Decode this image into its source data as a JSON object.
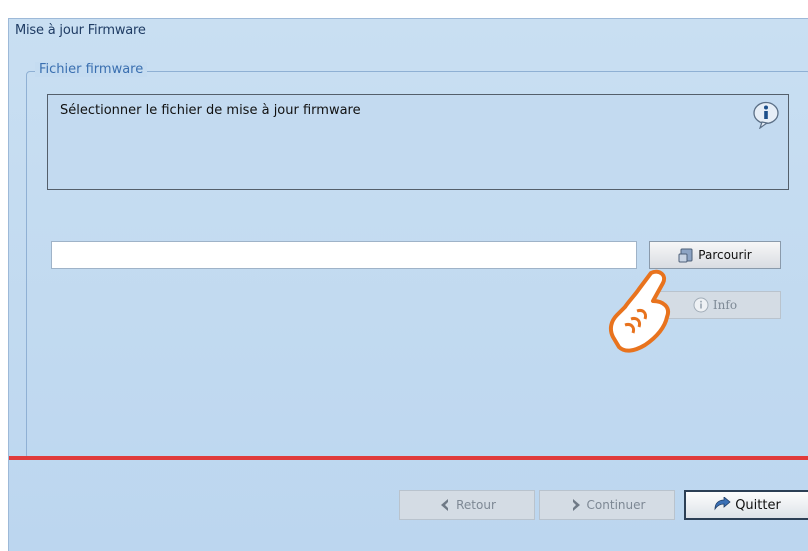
{
  "window": {
    "title": "Mise à jour Firmware"
  },
  "group": {
    "legend": "Fichier firmware",
    "info_text": "Sélectionner le fichier de mise à jour firmware"
  },
  "file_input": {
    "value": "",
    "placeholder": ""
  },
  "buttons": {
    "browse_label": "Parcourir",
    "info_label": "Info",
    "back_label": "Retour",
    "continue_label": "Continuer",
    "quit_label": "Quitter"
  },
  "icons": {
    "info_bubble": "info-bubble-icon",
    "browse": "folder-browse-icon",
    "info": "info-circle-icon",
    "back": "chevron-left-icon",
    "continue": "chevron-right-icon",
    "quit": "exit-icon",
    "pointer": "hand-pointer-icon"
  },
  "colors": {
    "accent_line": "#e03b3b",
    "legend_text": "#3a6fb0",
    "window_bg": "#c5dcf1"
  }
}
